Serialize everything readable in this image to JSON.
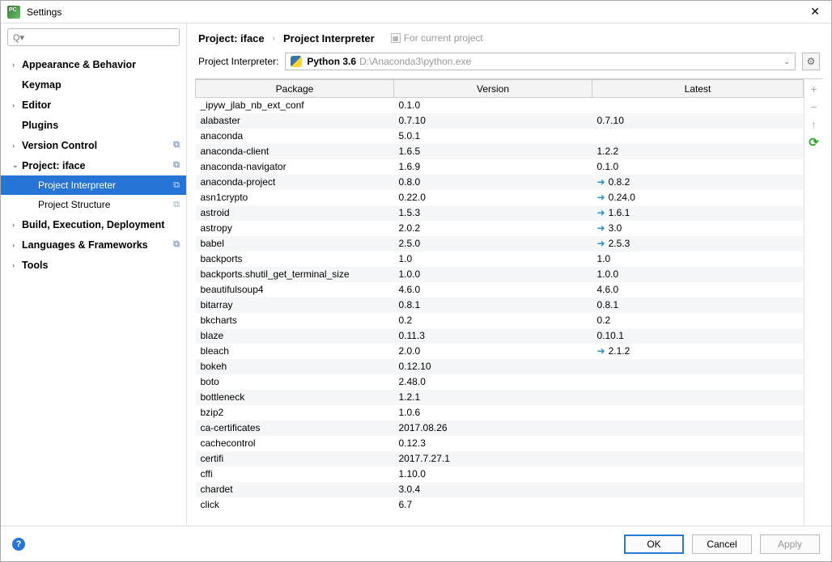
{
  "window": {
    "title": "Settings",
    "close": "✕"
  },
  "search": {
    "placeholder": ""
  },
  "sidebar": {
    "items": [
      {
        "label": "Appearance & Behavior",
        "arrow": "›",
        "bold": true
      },
      {
        "label": "Keymap",
        "arrow": "",
        "bold": true,
        "noarrow": true
      },
      {
        "label": "Editor",
        "arrow": "›",
        "bold": true
      },
      {
        "label": "Plugins",
        "arrow": "",
        "bold": true,
        "noarrow": true
      },
      {
        "label": "Version Control",
        "arrow": "›",
        "bold": true,
        "copy": true
      },
      {
        "label": "Project: iface",
        "arrow": "⌄",
        "bold": true,
        "copy": true,
        "expanded": true,
        "children": [
          {
            "label": "Project Interpreter",
            "selected": true,
            "copy": true
          },
          {
            "label": "Project Structure",
            "copy": true
          }
        ]
      },
      {
        "label": "Build, Execution, Deployment",
        "arrow": "›",
        "bold": true
      },
      {
        "label": "Languages & Frameworks",
        "arrow": "›",
        "bold": true,
        "copy": true
      },
      {
        "label": "Tools",
        "arrow": "›",
        "bold": true
      }
    ]
  },
  "breadcrumb": {
    "part1": "Project: iface",
    "part2": "Project Interpreter",
    "hint": "For current project"
  },
  "interpreter": {
    "label": "Project Interpreter:",
    "name": "Python 3.6",
    "path": "D:\\Anaconda3\\python.exe"
  },
  "table": {
    "headers": {
      "package": "Package",
      "version": "Version",
      "latest": "Latest"
    },
    "rows": [
      {
        "package": "_ipyw_jlab_nb_ext_conf",
        "version": "0.1.0",
        "latest": "",
        "update": false
      },
      {
        "package": "alabaster",
        "version": "0.7.10",
        "latest": "0.7.10",
        "update": false
      },
      {
        "package": "anaconda",
        "version": "5.0.1",
        "latest": "",
        "update": false
      },
      {
        "package": "anaconda-client",
        "version": "1.6.5",
        "latest": "1.2.2",
        "update": false
      },
      {
        "package": "anaconda-navigator",
        "version": "1.6.9",
        "latest": "0.1.0",
        "update": false
      },
      {
        "package": "anaconda-project",
        "version": "0.8.0",
        "latest": "0.8.2",
        "update": true
      },
      {
        "package": "asn1crypto",
        "version": "0.22.0",
        "latest": "0.24.0",
        "update": true
      },
      {
        "package": "astroid",
        "version": "1.5.3",
        "latest": "1.6.1",
        "update": true
      },
      {
        "package": "astropy",
        "version": "2.0.2",
        "latest": "3.0",
        "update": true
      },
      {
        "package": "babel",
        "version": "2.5.0",
        "latest": "2.5.3",
        "update": true
      },
      {
        "package": "backports",
        "version": "1.0",
        "latest": "1.0",
        "update": false
      },
      {
        "package": "backports.shutil_get_terminal_size",
        "version": "1.0.0",
        "latest": "1.0.0",
        "update": false
      },
      {
        "package": "beautifulsoup4",
        "version": "4.6.0",
        "latest": "4.6.0",
        "update": false
      },
      {
        "package": "bitarray",
        "version": "0.8.1",
        "latest": "0.8.1",
        "update": false
      },
      {
        "package": "bkcharts",
        "version": "0.2",
        "latest": "0.2",
        "update": false
      },
      {
        "package": "blaze",
        "version": "0.11.3",
        "latest": "0.10.1",
        "update": false
      },
      {
        "package": "bleach",
        "version": "2.0.0",
        "latest": "2.1.2",
        "update": true
      },
      {
        "package": "bokeh",
        "version": "0.12.10",
        "latest": "",
        "update": false
      },
      {
        "package": "boto",
        "version": "2.48.0",
        "latest": "",
        "update": false
      },
      {
        "package": "bottleneck",
        "version": "1.2.1",
        "latest": "",
        "update": false
      },
      {
        "package": "bzip2",
        "version": "1.0.6",
        "latest": "",
        "update": false
      },
      {
        "package": "ca-certificates",
        "version": "2017.08.26",
        "latest": "",
        "update": false
      },
      {
        "package": "cachecontrol",
        "version": "0.12.3",
        "latest": "",
        "update": false
      },
      {
        "package": "certifi",
        "version": "2017.7.27.1",
        "latest": "",
        "update": false
      },
      {
        "package": "cffi",
        "version": "1.10.0",
        "latest": "",
        "update": false
      },
      {
        "package": "chardet",
        "version": "3.0.4",
        "latest": "",
        "update": false
      },
      {
        "package": "click",
        "version": "6.7",
        "latest": "",
        "update": false
      }
    ]
  },
  "sidebuttons": {
    "add": "+",
    "remove": "−",
    "up": "↑",
    "refresh": "⟳"
  },
  "footer": {
    "ok": "OK",
    "cancel": "Cancel",
    "apply": "Apply"
  }
}
